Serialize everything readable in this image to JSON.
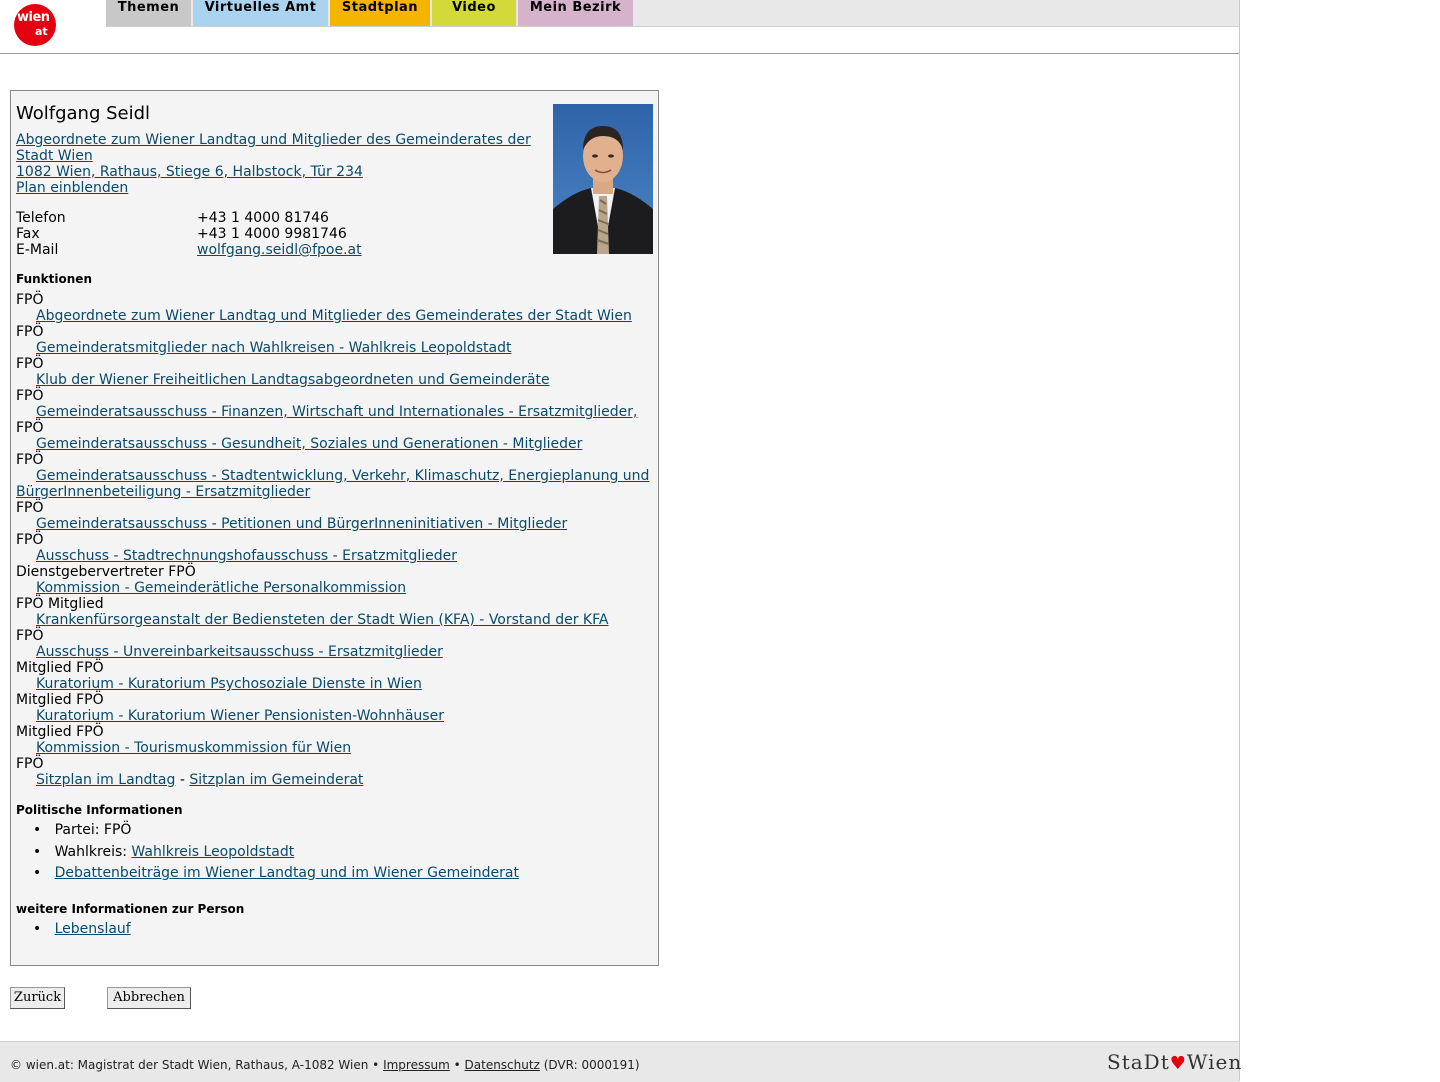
{
  "header": {
    "logo_text_1": "wien",
    "logo_text_2": "at",
    "nav": [
      {
        "label": "Themen",
        "color": "#c8c8c8"
      },
      {
        "label": "Virtuelles Amt",
        "color": "#a9d3ef"
      },
      {
        "label": "Stadtplan",
        "color": "#f5b400"
      },
      {
        "label": "Video",
        "color": "#d4d93a"
      },
      {
        "label": "Mein Bezirk",
        "color": "#d6b3cc"
      }
    ]
  },
  "person": {
    "name": "Wolfgang Seidl",
    "role_link_1": "Abgeordnete zum Wiener Landtag und Mitglieder des Gemeinderates der",
    "role_link_2": "Stadt Wien",
    "address_link": "1082 Wien, Rathaus, Stiege 6, Halbstock, Tür 234",
    "plan_link": "Plan einblenden",
    "phone_label": "Telefon",
    "phone": "+43 1 4000 81746",
    "fax_label": "Fax",
    "fax": "+43 1 4000 9981746",
    "email_label": "E-Mail",
    "email": "wolfgang.seidl@fpoe.at"
  },
  "functions_heading": "Funktionen",
  "functions": [
    {
      "party": "FPÖ",
      "link": "Abgeordnete zum Wiener Landtag und Mitglieder des Gemeinderates der Stadt Wien"
    },
    {
      "party": "FPÖ",
      "link": "Gemeinderatsmitglieder nach Wahlkreisen - Wahlkreis Leopoldstadt"
    },
    {
      "party": "FPÖ",
      "link": "Klub der Wiener Freiheitlichen Landtagsabgeordneten und Gemeinderäte"
    },
    {
      "party": "FPÖ",
      "link": "Gemeinderatsausschuss - Finanzen, Wirtschaft und Internationales - Ersatzmitglieder,"
    },
    {
      "party": "FPÖ",
      "link": "Gemeinderatsausschuss - Gesundheit, Soziales und Generationen - Mitglieder"
    },
    {
      "party": "FPÖ",
      "link": "Gemeinderatsausschuss - Stadtentwicklung, Verkehr, Klimaschutz, Energieplanung und",
      "link2": "BürgerInnenbeteiligung - Ersatzmitglieder"
    },
    {
      "party": "FPÖ",
      "link": "Gemeinderatsausschuss - Petitionen und BürgerInneninitiativen - Mitglieder"
    },
    {
      "party": "FPÖ",
      "link": "Ausschuss - Stadtrechnungshofausschuss - Ersatzmitglieder"
    },
    {
      "party": "Dienstgebervertreter FPÖ",
      "link": "Kommission - Gemeinderätliche Personalkommission"
    },
    {
      "party": "FPÖ Mitglied",
      "link": "Krankenfürsorgeanstalt der Bediensteten der Stadt Wien (KFA) - Vorstand der KFA"
    },
    {
      "party": "FPÖ",
      "link": "Ausschuss - Unvereinbarkeitsausschuss - Ersatzmitglieder"
    },
    {
      "party": "Mitglied FPÖ",
      "link": "Kuratorium - Kuratorium Psychosoziale Dienste in Wien"
    },
    {
      "party": "Mitglied FPÖ",
      "link": "Kuratorium - Kuratorium Wiener Pensionisten-Wohnhäuser"
    },
    {
      "party": "Mitglied FPÖ",
      "link": "Kommission - Tourismuskommission für Wien"
    }
  ],
  "seating": {
    "party": "FPÖ",
    "link_a": "Sitzplan im Landtag",
    "sep": "-",
    "link_b": "Sitzplan im Gemeinderat"
  },
  "political": {
    "heading": "Politische Informationen",
    "party_label": "Partei: FPÖ",
    "district_label": "Wahlkreis:",
    "district_link": "Wahlkreis Leopoldstadt",
    "debate_link": "Debattenbeiträge im Wiener Landtag und im Wiener Gemeinderat"
  },
  "more": {
    "heading": "weitere Informationen zur Person",
    "cv_link": "Lebenslauf"
  },
  "buttons": {
    "back": "Zurück",
    "cancel": "Abbrechen"
  },
  "footer": {
    "text_1": "© wien.at: Magistrat der Stadt Wien, Rathaus, A-1082 Wien •",
    "impressum": "Impressum",
    "bullet": "•",
    "datenschutz": "Datenschutz",
    "dvr": "(DVR: 0000191)",
    "brand_1": "StaDt",
    "brand_heart": "♥",
    "brand_2": "Wien"
  }
}
